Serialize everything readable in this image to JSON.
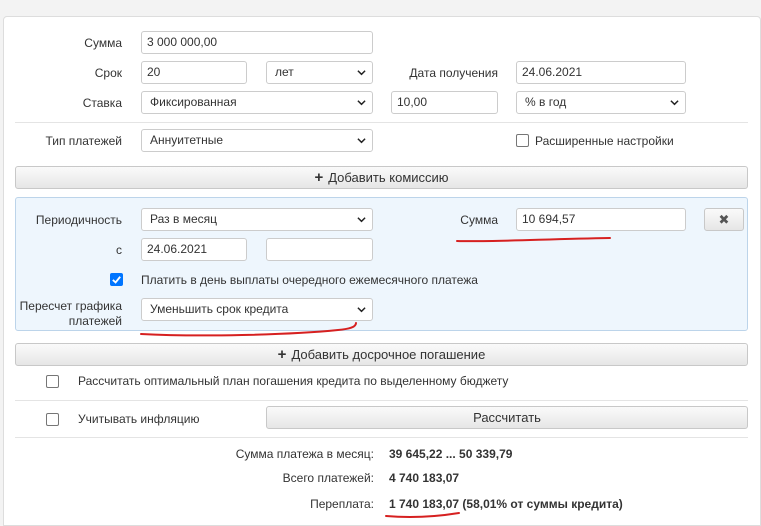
{
  "fields": {
    "sum_label": "Сумма",
    "sum_value": "3 000 000,00",
    "term_label": "Срок",
    "term_value": "20",
    "term_unit": "лет",
    "receive_date_label": "Дата получения",
    "receive_date_value": "24.06.2021",
    "rate_label": "Ставка",
    "rate_type": "Фиксированная",
    "rate_value": "10,00",
    "rate_unit": "% в год",
    "payment_type_label": "Тип платежей",
    "payment_type": "Аннуитетные",
    "advanced_label": "Расширенные настройки"
  },
  "add_commission_label": "Добавить комиссию",
  "early": {
    "periodicity_label": "Периодичность",
    "periodicity_value": "Раз в месяц",
    "sum_label": "Сумма",
    "sum_value": "10 694,57",
    "from_label": "с",
    "from_date": "24.06.2021",
    "to_date": "",
    "pay_on_day_label": "Платить в день выплаты очередного ежемесячного платежа",
    "recalc_label_1": "Пересчет графика",
    "recalc_label_2": "платежей",
    "recalc_value": "Уменьшить срок кредита",
    "remove_symbol": "✖"
  },
  "add_early_label": "Добавить досрочное погашение",
  "optimal_plan_label": "Рассчитать оптимальный план погашения кредита по выделенному бюджету",
  "inflation_label": "Учитывать инфляцию",
  "calculate_label": "Рассчитать",
  "results": {
    "monthly_label": "Сумма платежа в месяц:",
    "monthly_value": "39 645,22 ... 50 339,79",
    "total_label": "Всего платежей:",
    "total_value": "4 740 183,07",
    "overpay_label": "Переплата:",
    "overpay_value": "1 740 183,07 (58,01% от суммы кредита)"
  },
  "colors": {
    "accent": "#0075ff",
    "annotation": "#d62020"
  }
}
